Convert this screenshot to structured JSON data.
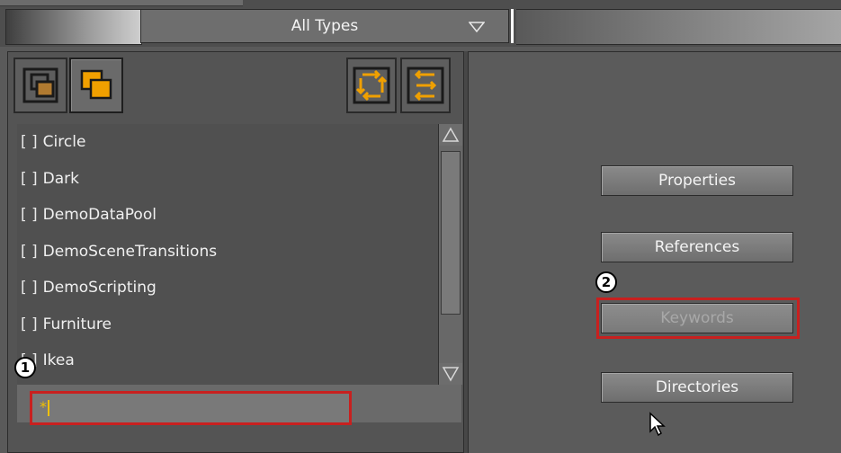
{
  "type_filter": {
    "selected": "All Types"
  },
  "toolbar": {
    "left_buttons": [
      "list-view-icon",
      "icon-view-icon"
    ],
    "right_buttons": [
      "sync-icon",
      "swap-icon"
    ]
  },
  "list": {
    "items": [
      {
        "check": "[ ]",
        "label": "Circle"
      },
      {
        "check": "[ ]",
        "label": "Dark"
      },
      {
        "check": "[ ]",
        "label": "DemoDataPool"
      },
      {
        "check": "[ ]",
        "label": "DemoSceneTransitions"
      },
      {
        "check": "[ ]",
        "label": "DemoScripting"
      },
      {
        "check": "[ ]",
        "label": "Furniture"
      },
      {
        "check": "[ ]",
        "label": "Ikea"
      }
    ]
  },
  "search": {
    "value": "*"
  },
  "callouts": {
    "one": "1",
    "two": "2"
  },
  "side_buttons": {
    "properties": "Properties",
    "references": "References",
    "keywords": "Keywords",
    "directories": "Directories"
  },
  "colors": {
    "highlight": "#c8201f",
    "accent": "#f0a000"
  }
}
